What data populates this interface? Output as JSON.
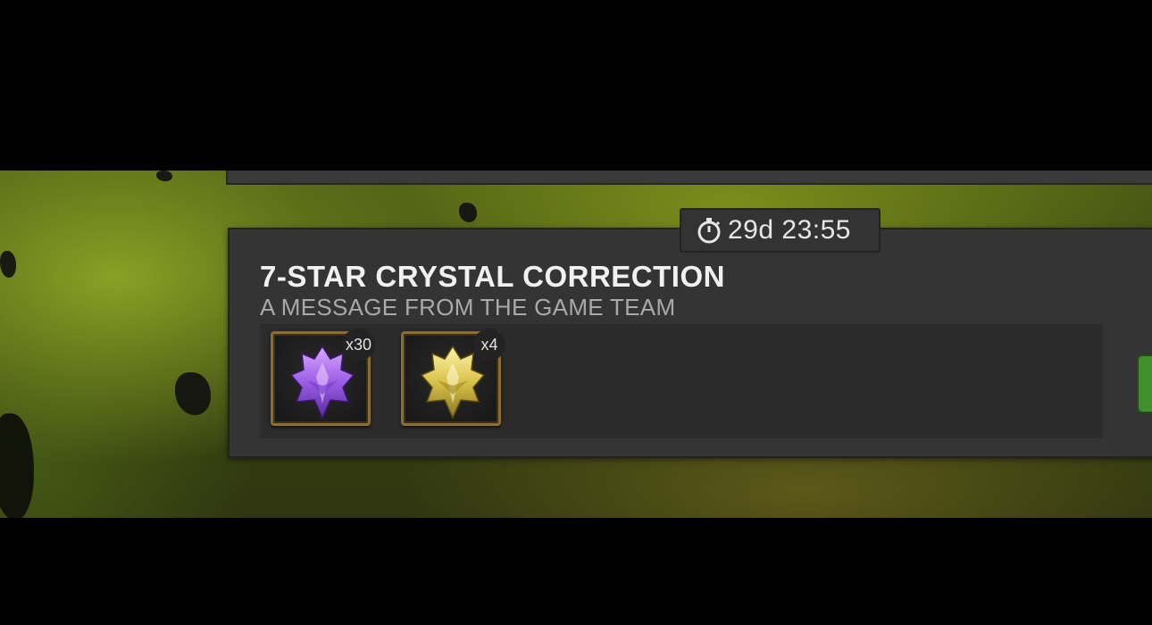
{
  "timer": {
    "icon": "stopwatch-icon",
    "text": "29d 23:55"
  },
  "message": {
    "title": "7-STAR CRYSTAL CORRECTION",
    "subtitle": "A MESSAGE FROM THE GAME TEAM"
  },
  "rewards": [
    {
      "name": "purple-crystal-shard",
      "quantity": "x30",
      "color": "#9b5de5"
    },
    {
      "name": "gold-crystal-shard",
      "quantity": "x4",
      "color": "#d9c24a"
    }
  ],
  "colors": {
    "card_bg": "#343434",
    "claim_button": "#3f8f2e",
    "frame_gold": "#8b6d36"
  }
}
